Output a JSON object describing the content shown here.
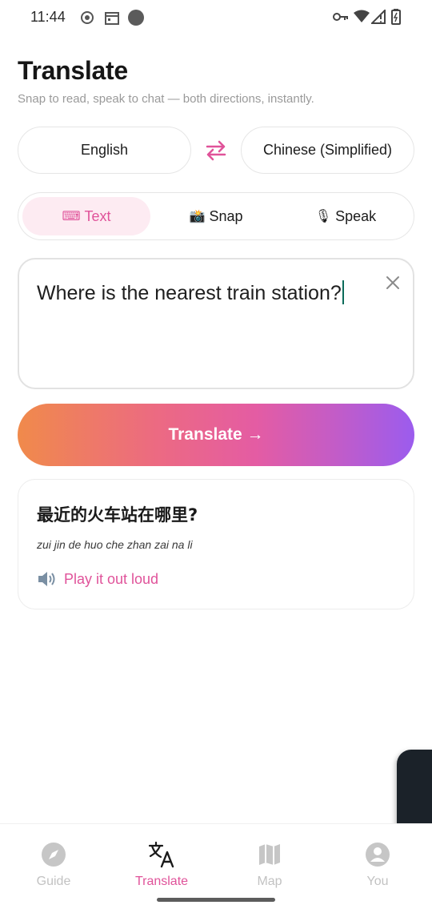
{
  "status_bar": {
    "time": "11:44",
    "icons": [
      "data-saver-icon",
      "calendar-icon",
      "dot-icon",
      "vpn-key-icon",
      "wifi-icon",
      "signal-icon",
      "battery-icon"
    ]
  },
  "header": {
    "title": "Translate",
    "subtitle": "Snap to read, speak to chat — both directions, instantly."
  },
  "languages": {
    "source": "English",
    "target": "Chinese (Simplified)",
    "swap_icon": "swap-arrows-icon"
  },
  "modes": {
    "tabs": [
      {
        "label": "Text",
        "icon": "⌨",
        "active": true
      },
      {
        "label": "Snap",
        "icon": "📸",
        "active": false
      },
      {
        "label": "Speak",
        "icon": "🎙",
        "active": false
      }
    ]
  },
  "input": {
    "value": "Where is the nearest train station?"
  },
  "actions": {
    "translate_label": "Translate →"
  },
  "result": {
    "translation": "最近的火车站在哪里?",
    "pinyin": "zui jin de huo che zhan zai na li",
    "play_label": "Play it out loud"
  },
  "nav": {
    "items": [
      {
        "label": "Guide",
        "icon": "compass-icon",
        "active": false
      },
      {
        "label": "Translate",
        "icon": "translate-icon",
        "active": true
      },
      {
        "label": "Map",
        "icon": "map-icon",
        "active": false
      },
      {
        "label": "You",
        "icon": "account-icon",
        "active": false
      }
    ]
  },
  "colors": {
    "accent": "#e0539a",
    "accent_light": "#fdebf2",
    "gradient_start": "#f08a4b",
    "gradient_end": "#9b5cee",
    "caret": "#0b6b5a"
  }
}
